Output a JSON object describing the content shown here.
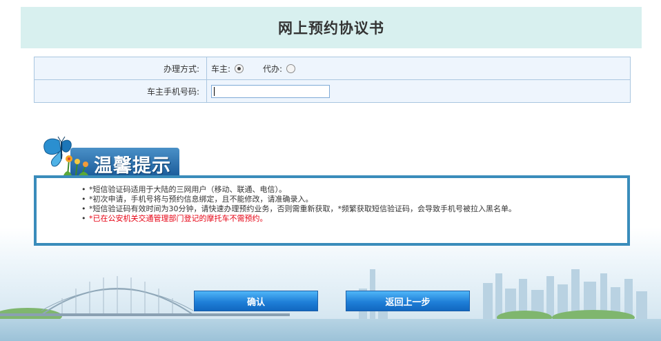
{
  "header": {
    "title": "网上预约协议书"
  },
  "form": {
    "method": {
      "label": "办理方式:",
      "options": [
        {
          "label": "车主:",
          "selected": true
        },
        {
          "label": "代办:",
          "selected": false
        }
      ]
    },
    "phone": {
      "label": "车主手机号码:",
      "value": ""
    }
  },
  "tips": {
    "banner_text": "温馨提示",
    "items": [
      "*短信验证码适用于大陆的三网用户（移动、联通、电信）。",
      "*初次申请，手机号将与预约信息绑定，且不能修改，请准确录入。",
      "*短信验证码有效时间为30分钟，请快速办理预约业务，否则需重新获取，*频繁获取短信验证码，会导致手机号被拉入黑名单。",
      "*已在公安机关交通管理部门登记的摩托车不需预约。"
    ]
  },
  "buttons": {
    "confirm": "确认",
    "back": "返回上一步"
  },
  "colors": {
    "header_bg": "#d8f0ef",
    "button_blue": "#1f7fd8",
    "tip_border": "#3a8cbb",
    "warning_red": "#e60012"
  }
}
